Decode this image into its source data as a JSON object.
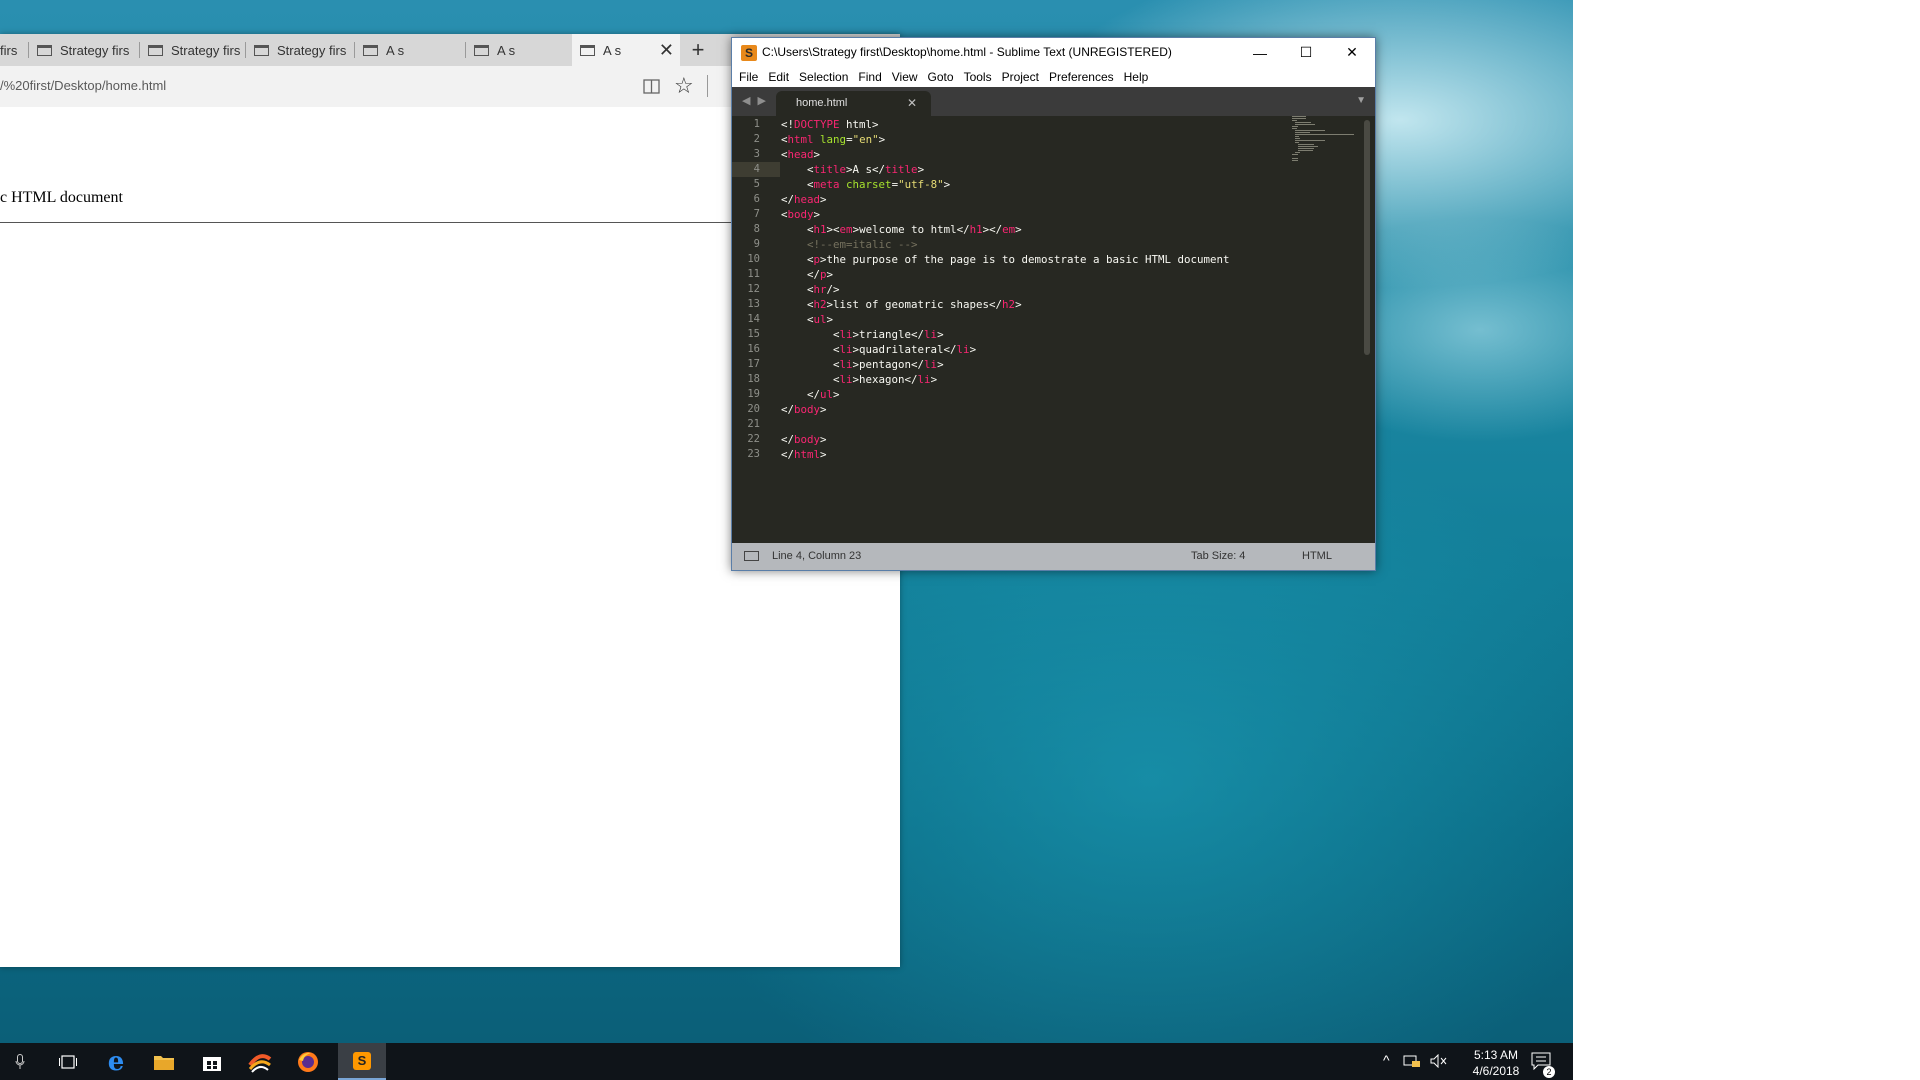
{
  "browser": {
    "tabs": [
      {
        "label": "firs",
        "active": false
      },
      {
        "label": "Strategy firs",
        "active": false
      },
      {
        "label": "Strategy firs",
        "active": false
      },
      {
        "label": "Strategy firs",
        "active": false
      },
      {
        "label": "A s",
        "active": false
      },
      {
        "label": "A s",
        "active": false
      },
      {
        "label": "A s",
        "active": true
      }
    ],
    "new_tab": "+",
    "close_tab": "✕",
    "url": "/%20first/Desktop/home.html",
    "favorite_glyph": "☆",
    "page_text": "c HTML document"
  },
  "sublime": {
    "title": "C:\\Users\\Strategy first\\Desktop\\home.html - Sublime Text (UNREGISTERED)",
    "logo_glyph": "S",
    "window_buttons": {
      "minimize": "—",
      "maximize": "☐",
      "close": "✕"
    },
    "menu": [
      "File",
      "Edit",
      "Selection",
      "Find",
      "View",
      "Goto",
      "Tools",
      "Project",
      "Preferences",
      "Help"
    ],
    "tab": {
      "label": "home.html",
      "close": "✕"
    },
    "nav_arrows": "◀ ▶",
    "dropdown": "▼",
    "line_numbers": [
      "1",
      "2",
      "3",
      "4",
      "5",
      "6",
      "7",
      "8",
      "9",
      "10",
      "11",
      "12",
      "13",
      "14",
      "15",
      "16",
      "17",
      "18",
      "19",
      "20",
      "21",
      "22",
      "23"
    ],
    "current_line": 4,
    "status": {
      "position": "Line 4, Column 23",
      "tab_size": "Tab Size: 4",
      "syntax": "HTML"
    }
  },
  "code_lines": [
    "<!DOCTYPE html>",
    "<html lang=\"en\">",
    "<head>",
    "    <title>A s</title>",
    "    <meta charset=\"utf-8\">",
    "</head>",
    "<body>",
    "    <h1><em>welcome to html</h1></em>",
    "    <!--em=italic -->",
    "    <p>the purpose of the page is to demostrate a basic HTML document",
    "    </p>",
    "    <hr/>",
    "    <h2>list of geomatric shapes</h2>",
    "    <ul>",
    "        <li>triangle</li>",
    "        <li>quadrilateral</li>",
    "        <li>pentagon</li>",
    "        <li>hexagon</li>",
    "    </ul>",
    "</body>",
    "",
    "</body>",
    "</html>"
  ],
  "taskbar": {
    "icons": [
      "microphone-icon",
      "task-view-icon",
      "edge-icon",
      "file-explorer-icon",
      "store-icon",
      "colorful-app-icon",
      "firefox-icon",
      "sublime-text-icon"
    ],
    "tray_chevron": "^",
    "time": "5:13 AM",
    "date": "4/6/2018",
    "notification_count": "2"
  },
  "colors": {
    "tag": "#f92672",
    "attr": "#a6e22e",
    "string": "#e6db74",
    "comment": "#75715e",
    "text": "#f8f8f2",
    "editor_bg": "#272822"
  }
}
